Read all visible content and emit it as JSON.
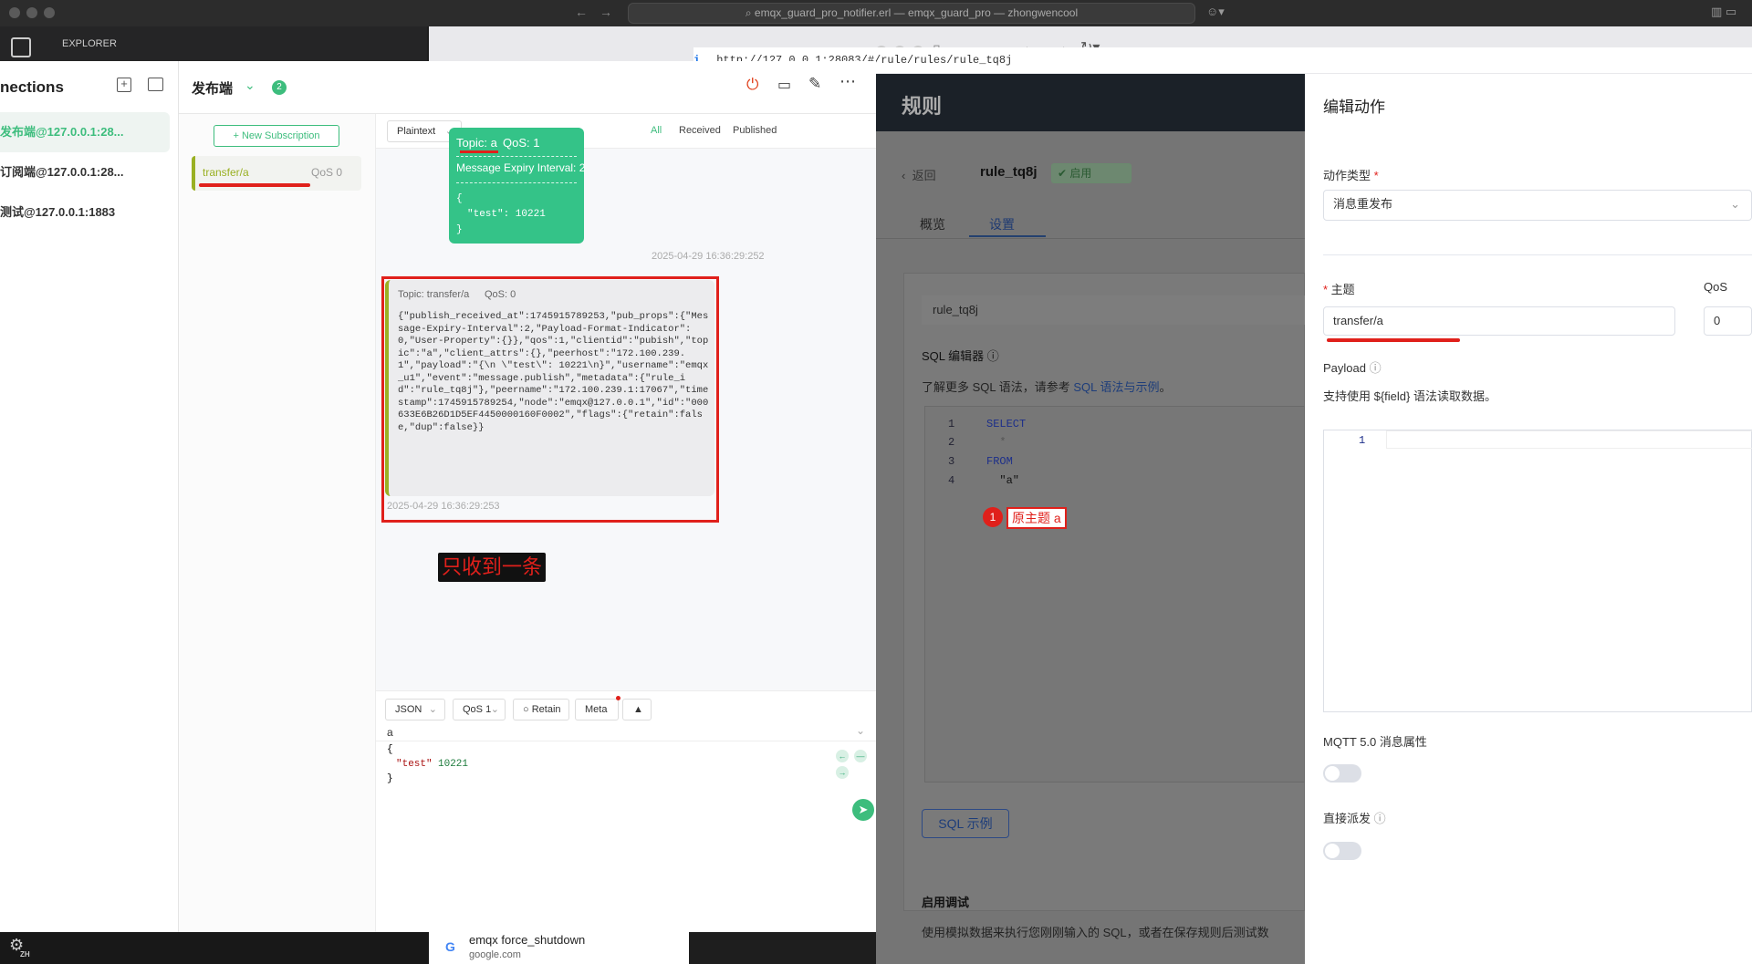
{
  "vscode": {
    "command_center": "emqx_guard_pro_notifier.erl — emqx_guard_pro — zhongwencool",
    "explorer": "EXPLORER",
    "lang_badge": "ZH"
  },
  "mqttx": {
    "connections_title": "nections",
    "connections": [
      "发布端@127.0.0.1:28...",
      "订阅端@127.0.0.1:28...",
      "测试@127.0.0.1:1883"
    ],
    "active_conn": "发布端",
    "conn_badge": "2",
    "new_subscription": "New Subscription",
    "subscription": {
      "topic": "transfer/a",
      "qos": "QoS 0"
    },
    "payload_type": "Plaintext",
    "filters": {
      "all": "All",
      "received": "Received",
      "published": "Published"
    },
    "published": {
      "topic": "Topic: a",
      "qos": "QoS: 1",
      "expiry": "Message Expiry Interval: 2",
      "body_open": "{",
      "body_line": "\"test\": 10221",
      "body_close": "}",
      "time": "2025-04-29 16:36:29:252"
    },
    "received": {
      "topic": "Topic: transfer/a",
      "qos": "QoS: 0",
      "payload": "{\"publish_received_at\":1745915789253,\"pub_props\":{\"Message-Expiry-Interval\":2,\"Payload-Format-Indicator\":0,\"User-Property\":{}},\"qos\":1,\"clientid\":\"pubish\",\"topic\":\"a\",\"client_attrs\":{},\"peerhost\":\"172.100.239.1\",\"payload\":\"{\\n \\\"test\\\": 10221\\n}\",\"username\":\"emqx_u1\",\"event\":\"message.publish\",\"metadata\":{\"rule_id\":\"rule_tq8j\"},\"peername\":\"172.100.239.1:17067\",\"timestamp\":1745915789254,\"node\":\"emqx@127.0.0.1\",\"id\":\"000633E6B26D1D5EF4450000160F0002\",\"flags\":{\"retain\":false,\"dup\":false}}",
      "time": "2025-04-29 16:36:29:253"
    },
    "annotation": "只收到一条",
    "composer": {
      "format": "JSON",
      "qos": "QoS 1",
      "retain": "Retain",
      "meta": "Meta",
      "topic": "a",
      "body_open": "{",
      "body_key": "\"test\"",
      "body_val": "10221",
      "body_close": "}"
    }
  },
  "browser": {
    "url": "http://127.0.0.1:28083/#/rule/rules/rule_tq8j",
    "search_title": "emqx force_shutdown",
    "search_site": "google.com"
  },
  "emqx": {
    "page_title": "规则",
    "back": "返回",
    "rule_name": "rule_tq8j",
    "status": "启用",
    "tabs": [
      "概览",
      "设置"
    ],
    "rule_id_value": "rule_tq8j",
    "sql_editor_label": "SQL 编辑器",
    "sql_help_prefix": "了解更多 SQL 语法，请参考 ",
    "sql_help_link": "SQL 语法与示例",
    "sql_help_suffix": "。",
    "sql_lines": [
      "SELECT",
      "  *",
      "FROM",
      "  \"a\""
    ],
    "line_nums": [
      "1",
      "2",
      "3",
      "4"
    ],
    "callout_num": "1",
    "callout_text": "原主题 a",
    "sql_example_btn": "SQL 示例",
    "debug_title": "启用调试",
    "debug_desc": "使用模拟数据来执行您刚刚输入的 SQL，或者在保存规则后测试数"
  },
  "action_panel": {
    "title": "编辑动作",
    "action_type_label": "动作类型",
    "action_type_value": "消息重发布",
    "topic_label": "主题",
    "topic_value": "transfer/a",
    "qos_label": "QoS",
    "qos_value": "0",
    "payload_label": "Payload",
    "payload_help": "支持使用 ${field} 语法读取数据。",
    "payload_line": "1",
    "mqtt5_label": "MQTT 5.0 消息属性",
    "direct_label": "直接派发"
  }
}
